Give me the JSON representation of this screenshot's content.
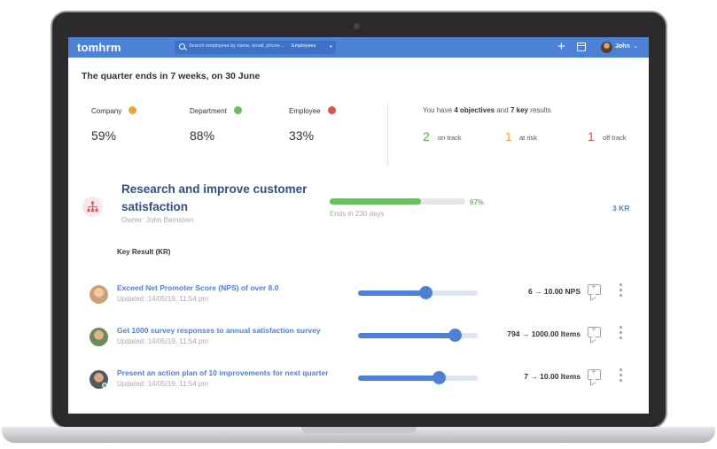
{
  "header": {
    "logo": "tomhrm",
    "search": {
      "placeholder": "Search employees by name, email, phone...",
      "scope": "Employees"
    },
    "user": {
      "name": "John"
    },
    "colors": {
      "bar": "#4c81d6"
    }
  },
  "headline": "The quarter ends in 7 weeks, on 30 June",
  "stats": [
    {
      "label": "Company",
      "value": "59%",
      "color": "#f0a33a"
    },
    {
      "label": "Department",
      "value": "88%",
      "color": "#6cbd63"
    },
    {
      "label": "Employee",
      "value": "33%",
      "color": "#d9534f"
    }
  ],
  "summary": {
    "prefix": "You have",
    "objectives": "4 objectives",
    "and": "and",
    "key_results": "7 key",
    "suffix": "results",
    "on_track": {
      "count": "2",
      "label": "on track",
      "color": "#5aa550"
    },
    "at_risk": {
      "count": "1",
      "label": "at risk",
      "color": "#f0a33a"
    },
    "off_track": {
      "count": "1",
      "label": "off track",
      "color": "#d9534f"
    }
  },
  "objective": {
    "title": "Research and improve customer satisfaction",
    "owner": "Owner: John Bernstein",
    "progress_label": "67%",
    "progress": 0.67,
    "ends": "Ends in 230 days",
    "kr_count": "3 KR"
  },
  "kr_heading": "Key Result (KR)",
  "key_results": [
    {
      "title": "Exceed Net Promoter Score (NPS) of over 8.0",
      "updated": "Updated: 14/05/19, 11:54 pm",
      "value": "6 → 10.00 NPS",
      "progress": 0.57
    },
    {
      "title": "Get 1000 survey responses to annual satisfaction survey",
      "updated": "Updated: 14/05/19, 11:54 pm",
      "value": "794 → 1000.00 Items",
      "progress": 0.81
    },
    {
      "title": "Present an action plan of 10 improvements for next quarter",
      "updated": "Updated: 14/05/19, 11:54 pm",
      "value": "7 → 10.00 Items",
      "progress": 0.68
    }
  ]
}
